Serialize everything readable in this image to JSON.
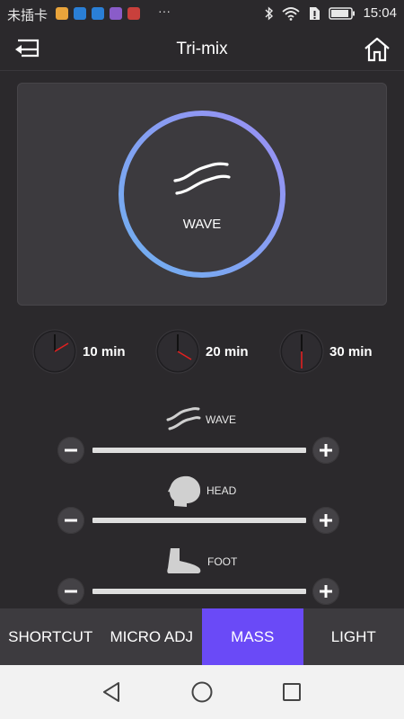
{
  "status_bar": {
    "carrier": "未插卡",
    "more": "···",
    "time": "15:04",
    "app_icons": [
      {
        "name": "photos-app-icon",
        "color": "#e9a43b"
      },
      {
        "name": "video-app-icon",
        "color": "#2a7fd6"
      },
      {
        "name": "video-app-icon-2",
        "color": "#2a7fd6"
      },
      {
        "name": "gallery-app-icon",
        "color": "#8a5cc9"
      },
      {
        "name": "mail-app-icon",
        "color": "#c9403c"
      }
    ]
  },
  "header": {
    "title": "Tri-mix",
    "back_icon": "back-arrow-icon",
    "home_icon": "home-icon"
  },
  "mode": {
    "label": "WAVE",
    "icon": "wave-icon",
    "ring_colors": [
      "#6fb0f0",
      "#9a8ff4"
    ]
  },
  "timers": [
    {
      "label": "10 min"
    },
    {
      "label": "20 min"
    },
    {
      "label": "30 min"
    }
  ],
  "zones": [
    {
      "label": "WAVE",
      "icon": "wave-icon"
    },
    {
      "label": "HEAD",
      "icon": "head-icon"
    },
    {
      "label": "FOOT",
      "icon": "foot-icon"
    }
  ],
  "tabs": [
    {
      "label": "SHORTCUT",
      "active": false
    },
    {
      "label": "MICRO ADJ",
      "active": false
    },
    {
      "label": "MASS",
      "active": true
    },
    {
      "label": "LIGHT",
      "active": false
    }
  ],
  "colors": {
    "background": "#2b292c",
    "accent": "#6a4af7",
    "clock_hand": "#e02020"
  }
}
